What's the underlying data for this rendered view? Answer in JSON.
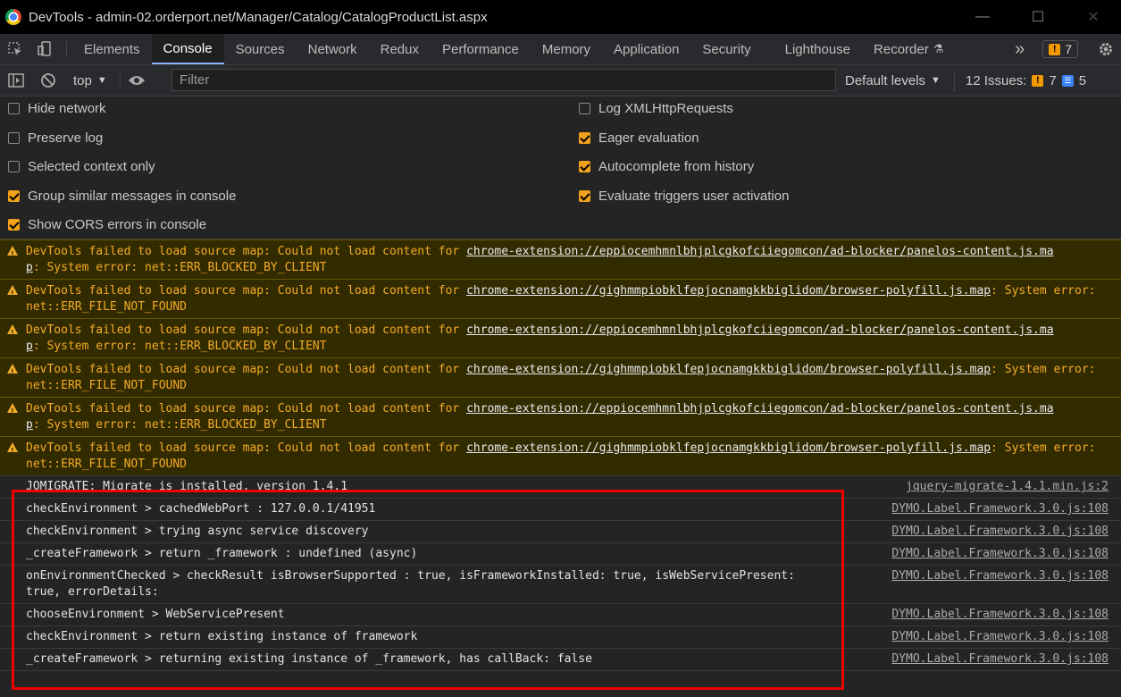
{
  "window": {
    "title": "DevTools - admin-02.orderport.net/Manager/Catalog/CatalogProductList.aspx"
  },
  "tabs": [
    {
      "label": "Elements"
    },
    {
      "label": "Console"
    },
    {
      "label": "Sources"
    },
    {
      "label": "Network"
    },
    {
      "label": "Redux"
    },
    {
      "label": "Performance"
    },
    {
      "label": "Memory"
    },
    {
      "label": "Application"
    },
    {
      "label": "Security"
    },
    {
      "label": "Lighthouse"
    },
    {
      "label": "Recorder"
    }
  ],
  "tab_more": "»",
  "warnings_badge": "7",
  "toolbar": {
    "context": "top",
    "filter_placeholder": "Filter",
    "levels": "Default levels",
    "issues_label": "12 Issues:",
    "issues_warn": "7",
    "issues_info": "5"
  },
  "settings": {
    "left": [
      {
        "label": "Hide network",
        "checked": false
      },
      {
        "label": "Preserve log",
        "checked": false
      },
      {
        "label": "Selected context only",
        "checked": false
      },
      {
        "label": "Group similar messages in console",
        "checked": true
      },
      {
        "label": "Show CORS errors in console",
        "checked": true
      }
    ],
    "right": [
      {
        "label": "Log XMLHttpRequests",
        "checked": false
      },
      {
        "label": "Eager evaluation",
        "checked": true
      },
      {
        "label": "Autocomplete from history",
        "checked": true
      },
      {
        "label": "Evaluate triggers user activation",
        "checked": true
      }
    ]
  },
  "warnings": [
    {
      "pre": "DevTools failed to load source map: Could not load content for ",
      "link": "chrome-extension://eppiocemhmnlbhjplcgkofciiegomcon/ad-blocker/panelos-content.js.ma",
      "link2": "p",
      "post": ": System error: net::ERR_BLOCKED_BY_CLIENT"
    },
    {
      "pre": "DevTools failed to load source map: Could not load content for ",
      "link": "chrome-extension://gighmmpiobklfepjocnamgkkbiglidom/browser-polyfill.js.map",
      "link2": "",
      "post": ": System error: net::ERR_FILE_NOT_FOUND"
    },
    {
      "pre": "DevTools failed to load source map: Could not load content for ",
      "link": "chrome-extension://eppiocemhmnlbhjplcgkofciiegomcon/ad-blocker/panelos-content.js.ma",
      "link2": "p",
      "post": ": System error: net::ERR_BLOCKED_BY_CLIENT"
    },
    {
      "pre": "DevTools failed to load source map: Could not load content for ",
      "link": "chrome-extension://gighmmpiobklfepjocnamgkkbiglidom/browser-polyfill.js.map",
      "link2": "",
      "post": ": System error: net::ERR_FILE_NOT_FOUND"
    },
    {
      "pre": "DevTools failed to load source map: Could not load content for ",
      "link": "chrome-extension://eppiocemhmnlbhjplcgkofciiegomcon/ad-blocker/panelos-content.js.ma",
      "link2": "p",
      "post": ": System error: net::ERR_BLOCKED_BY_CLIENT"
    },
    {
      "pre": "DevTools failed to load source map: Could not load content for ",
      "link": "chrome-extension://gighmmpiobklfepjocnamgkkbiglidom/browser-polyfill.js.map",
      "link2": "",
      "post": ": System error: net::ERR_FILE_NOT_FOUND"
    }
  ],
  "logs": [
    {
      "text": "JQMIGRATE: Migrate is installed, version 1.4.1",
      "source": "jquery-migrate-1.4.1.min.js:2"
    },
    {
      "text": "checkEnvironment > cachedWebPort : 127.0.0.1/41951",
      "source": "DYMO.Label.Framework.3.0.js:108"
    },
    {
      "text": "checkEnvironment > trying async service discovery",
      "source": "DYMO.Label.Framework.3.0.js:108"
    },
    {
      "text": "_createFramework > return _framework : undefined (async)",
      "source": "DYMO.Label.Framework.3.0.js:108"
    },
    {
      "text": "onEnvironmentChecked > checkResult isBrowserSupported : true, isFrameworkInstalled: true, isWebServicePresent:",
      "text2": "true, errorDetails:",
      "source": "DYMO.Label.Framework.3.0.js:108"
    },
    {
      "text": "chooseEnvironment > WebServicePresent",
      "source": "DYMO.Label.Framework.3.0.js:108"
    },
    {
      "text": "checkEnvironment > return existing instance of framework",
      "source": "DYMO.Label.Framework.3.0.js:108"
    },
    {
      "text": "_createFramework > returning existing instance of _framework, has callBack: false",
      "source": "DYMO.Label.Framework.3.0.js:108"
    }
  ]
}
